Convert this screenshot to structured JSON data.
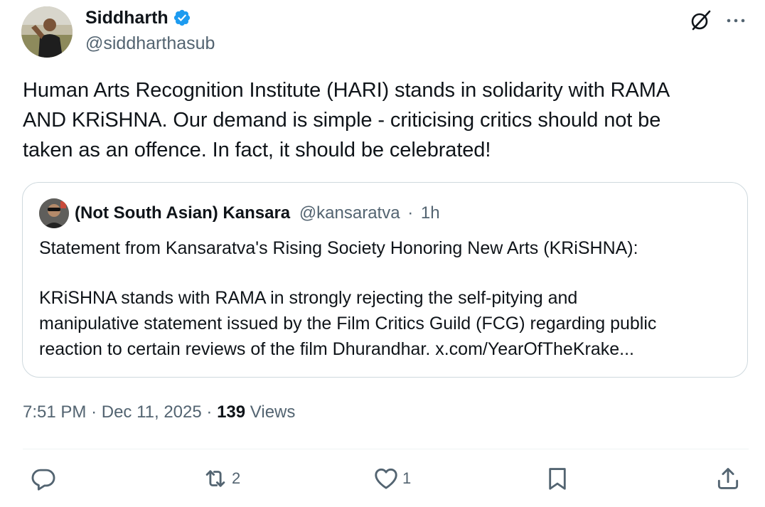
{
  "author": {
    "name": "Siddharth",
    "handle": "@siddharthasub",
    "verified": true,
    "verified_color": "#1d9bf0"
  },
  "tweet": {
    "lines": [
      "Human Arts Recognition Institute (HARI) stands in solidarity with RAMA",
      "AND KRiSHNA. Our demand is simple - criticising critics should not be",
      "taken as an offence. In fact, it should be celebrated!"
    ]
  },
  "quote": {
    "name": "(Not South Asian) Kansara",
    "handle": "@kansaratva",
    "separator": "·",
    "time": "1h",
    "paragraph1": "Statement from Kansaratva's Rising Society Honoring New Arts (KRiSHNA):",
    "paragraph2_lines": [
      "KRiSHNA stands with RAMA in strongly rejecting the self-pitying and",
      "manipulative statement issued by the Film Critics Guild (FCG) regarding public",
      "reaction to certain reviews of the film Dhurandhar. x.com/YearOfTheKrake..."
    ]
  },
  "meta": {
    "time": "7:51 PM",
    "sep1": "·",
    "date": "Dec 11, 2025",
    "sep2": "·",
    "views_count": "139",
    "views_label": "Views"
  },
  "actions": {
    "reply": {
      "icon": "reply-icon",
      "count": ""
    },
    "repost": {
      "icon": "repost-icon",
      "count": "2"
    },
    "like": {
      "icon": "heart-icon",
      "count": "1"
    },
    "bookmark": {
      "icon": "bookmark-icon",
      "count": ""
    },
    "share": {
      "icon": "share-icon",
      "count": ""
    }
  },
  "colors": {
    "text": "#0f1419",
    "secondary": "#536471",
    "border": "#cfd9de",
    "divider": "#eff3f4"
  }
}
